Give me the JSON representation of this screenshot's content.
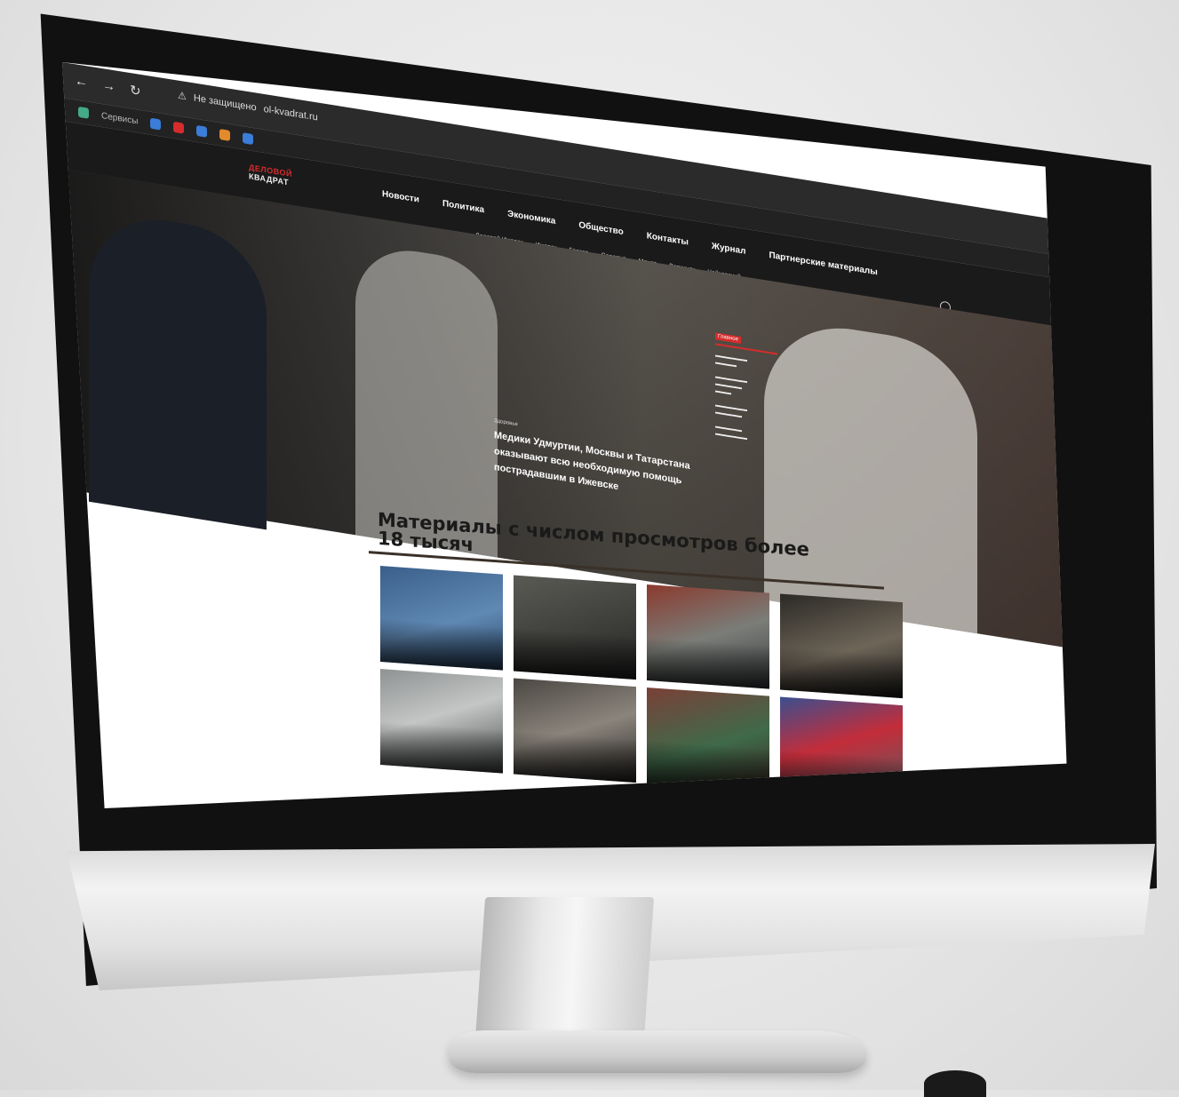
{
  "browser": {
    "back_icon": "←",
    "forward_icon": "→",
    "reload_icon": "↻",
    "security_warning": "Не защищено",
    "url": "ol-kvadrat.ru",
    "bookmarks": [
      "Сервисы"
    ]
  },
  "site": {
    "logo_line1": "ДЕЛОВОЙ",
    "logo_line2": "КВАДРАТ",
    "main_nav": [
      "Новости",
      "Политика",
      "Экономика",
      "Общество",
      "Контакты",
      "Журнал",
      "Партнерские материалы"
    ],
    "sub_nav": [
      "Деловой Ижевск",
      "Ижевск",
      "Глазов",
      "Сарапул",
      "Можга",
      "Воткинск",
      "Чайковский"
    ]
  },
  "hero": {
    "badge": "Здоровье",
    "title": "Медики Удмуртии, Москвы и Татарстана оказывают всю необходимую помощь пострадавшим в Ижевске",
    "side_feed_tag": "Главное"
  },
  "section": {
    "title_line1": "Материалы с числом просмотров более",
    "title_line2": "18 тысяч"
  },
  "colors": {
    "accent": "#d62c2c",
    "header_bg": "#1a1a1a",
    "rule": "#3a3128"
  }
}
